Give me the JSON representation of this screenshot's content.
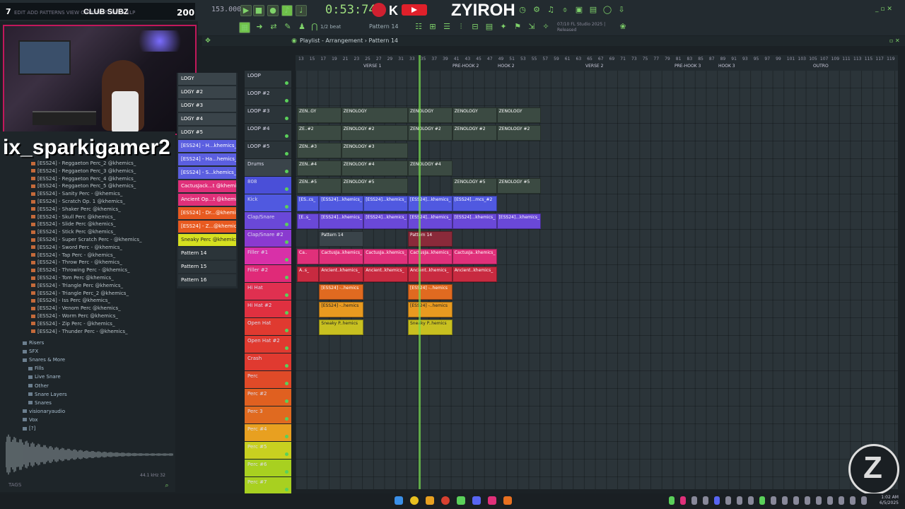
{
  "header": {
    "tempo": "153.000",
    "time": "0:53:74",
    "streamer_tag": "ZYIROH",
    "pattern": "Pattern 14",
    "snap": "1/2 beat",
    "fl_info_line1": "07/10 FL Studio 2025 |",
    "fl_info_line2": "Released"
  },
  "overlay": {
    "sub_index": "7",
    "sub_strip": "EDIT  ADD  PATTERNS  VIEW  OPTIONS  TOOLS  HELP",
    "sub_title": "CLUB SUBZ",
    "sub_count": "200",
    "username": "ix_sparkigamer2"
  },
  "breadcrumb": "Playlist - Arrangement  ›  Pattern 14",
  "browser": {
    "items": [
      "[ESS24] - Reggaeton Perc_2 @khemics_",
      "[ESS24] - Reggaeton Perc_3 @khemics_",
      "[ESS24] - Reggaeton Perc_4 @khemics_",
      "[ESS24] - Reggaeton Perc_5 @khemics_",
      "[ESS24] - Sanity Perc - @khemics_",
      "[ESS24] - Scratch Op. 1 @khemics_",
      "[ESS24] - Shaker Perc @khemics_",
      "[ESS24] - Skull Perc @khemics_",
      "[ESS24] - Slide Perc @khemics_",
      "[ESS24] - Stick Perc @khemics_",
      "[ESS24] - Super Scratch Perc - @khemics_",
      "[ESS24] - Sword Perc - @khemics_",
      "[ESS24] - Tap Perc - @khemics_",
      "[ESS24] - Throw Perc - @khemics_",
      "[ESS24] - Throwing Perc - @khemics_",
      "[ESS24] - Tom Perc @khemics_",
      "[ESS24] - Triangle Perc @khemics_",
      "[ESS24] - Triangle Perc_2 @khemics_",
      "[ESS24] - Iss Perc @khemics_",
      "[ESS24] - Venom Perc @khemics_",
      "[ESS24] - Worm Perc @khemics_",
      "[ESS24] - Zip Perc - @khemics_",
      "[ESS24] - Thunder Perc - @khemics_"
    ],
    "folders": [
      {
        "label": "Risers",
        "indent": 1
      },
      {
        "label": "SFX",
        "indent": 1
      },
      {
        "label": "Snares & More",
        "indent": 1
      },
      {
        "label": "Fills",
        "indent": 2
      },
      {
        "label": "Live Snare",
        "indent": 2
      },
      {
        "label": "Other",
        "indent": 2
      },
      {
        "label": "Snare Layers",
        "indent": 2
      },
      {
        "label": "Snares",
        "indent": 2
      },
      {
        "label": "visionaryaudio",
        "indent": 1
      },
      {
        "label": "Vox",
        "indent": 1
      },
      {
        "label": "[?]",
        "indent": 1
      }
    ],
    "sample_rate": "44.1 kHz 32",
    "tags_label": "TAGS"
  },
  "picker": [
    {
      "label": "LOGY",
      "color": "#3a444a"
    },
    {
      "label": "LOGY #2",
      "color": "#3a444a"
    },
    {
      "label": "LOGY #3",
      "color": "#3a444a"
    },
    {
      "label": "LOGY #4",
      "color": "#3a444a"
    },
    {
      "label": "LOGY #5",
      "color": "#3a444a"
    },
    {
      "label": "[ESS24] - H...khemics_",
      "color": "#5b5fe0"
    },
    {
      "label": "[ESS24] - Ha...hemics_#2",
      "color": "#5b5fe0"
    },
    {
      "label": "[ESS24] - S...khemics_",
      "color": "#5b5fe0"
    },
    {
      "label": "CactusJack...t @khemics",
      "color": "#e0307a"
    },
    {
      "label": "Ancient Op...t @khemics",
      "color": "#e0307a"
    },
    {
      "label": "[ESS24] - Dr...@khemics",
      "color": "#e85a20"
    },
    {
      "label": "[ESS24] - Z...@khemics",
      "color": "#e85a20"
    },
    {
      "label": "Sneaky Perc @khemics_",
      "color": "#d6e020"
    },
    {
      "label": "Pattern 14",
      "color": "#2b3439"
    },
    {
      "label": "Pattern 15",
      "color": "#2b3439"
    },
    {
      "label": "Pattern 16",
      "color": "#2b3439"
    }
  ],
  "tracks": [
    {
      "label": "LOOP",
      "color": "#2b3439"
    },
    {
      "label": "LOOP #2",
      "color": "#2b3439"
    },
    {
      "label": "LOOP #3",
      "color": "#2b3439"
    },
    {
      "label": "LOOP #4",
      "color": "#2b3439"
    },
    {
      "label": "LOOP #5",
      "color": "#2b3439"
    },
    {
      "label": "Drums",
      "color": "#3a444a"
    },
    {
      "label": "808",
      "color": "#4a4fd8"
    },
    {
      "label": "Kick",
      "color": "#5059e0"
    },
    {
      "label": "Clap/Snare",
      "color": "#6a48d8"
    },
    {
      "label": "Clap/Snare #2",
      "color": "#8a3ad0"
    },
    {
      "label": "Filler #1",
      "color": "#d830a8"
    },
    {
      "label": "Filler #2",
      "color": "#e02a78"
    },
    {
      "label": "Hi Hat",
      "color": "#e03050"
    },
    {
      "label": "Hi Hat #2",
      "color": "#e03040"
    },
    {
      "label": "Open Hat",
      "color": "#e03a30"
    },
    {
      "label": "Open Hat #2",
      "color": "#e03a30"
    },
    {
      "label": "Crash",
      "color": "#e03a30"
    },
    {
      "label": "Perc",
      "color": "#e04a28"
    },
    {
      "label": "Perc #2",
      "color": "#e06020"
    },
    {
      "label": "Perc 3",
      "color": "#e06a20"
    },
    {
      "label": "Perc #4",
      "color": "#e8a020"
    },
    {
      "label": "Perc #5",
      "color": "#c8d020"
    },
    {
      "label": "Perc #6",
      "color": "#a8d020"
    },
    {
      "label": "Perc #7",
      "color": "#a8d020"
    }
  ],
  "ruler": {
    "numbers": [
      "13",
      "15",
      "17",
      "19",
      "21",
      "23",
      "25",
      "27",
      "29",
      "31",
      "33",
      "35",
      "37",
      "39",
      "41",
      "43",
      "45",
      "47",
      "49",
      "51",
      "53",
      "55",
      "57",
      "59",
      "61",
      "63",
      "65",
      "67",
      "69",
      "71",
      "73",
      "75",
      "77",
      "79",
      "81",
      "83",
      "85",
      "87",
      "89",
      "91",
      "93",
      "95",
      "97",
      "99",
      "101",
      "103",
      "105",
      "107",
      "109",
      "111",
      "113",
      "115",
      "117",
      "119"
    ],
    "markers": [
      "VERSE 1",
      "PRE-HOOK 2",
      "HOOK 2",
      "VERSE 2",
      "PRE-HOOK 3",
      "HOOK 3",
      "OUTRO"
    ]
  },
  "clips": [
    {
      "row": 2,
      "start": 0,
      "len": 4,
      "label": "ZEN..GY",
      "color": "#3b4a42"
    },
    {
      "row": 2,
      "start": 4,
      "len": 6,
      "label": "ZENOLOGY",
      "color": "#3b4a42"
    },
    {
      "row": 2,
      "start": 10,
      "len": 4,
      "label": "ZENOLOGY",
      "color": "#3b4a42"
    },
    {
      "row": 2,
      "start": 14,
      "len": 4,
      "label": "ZENOLOGY",
      "color": "#3b4a42"
    },
    {
      "row": 2,
      "start": 18,
      "len": 4,
      "label": "ZENOLOGY",
      "color": "#3b4a42"
    },
    {
      "row": 3,
      "start": 0,
      "len": 4,
      "label": "ZE..#2",
      "color": "#3b4a42"
    },
    {
      "row": 3,
      "start": 4,
      "len": 6,
      "label": "ZENOLOGY #2",
      "color": "#3b4a42"
    },
    {
      "row": 3,
      "start": 10,
      "len": 4,
      "label": "ZENOLOGY #2",
      "color": "#3b4a42"
    },
    {
      "row": 3,
      "start": 14,
      "len": 4,
      "label": "ZENOLOGY #2",
      "color": "#3b4a42"
    },
    {
      "row": 3,
      "start": 18,
      "len": 4,
      "label": "ZENOLOGY #2",
      "color": "#3b4a42"
    },
    {
      "row": 4,
      "start": 0,
      "len": 4,
      "label": "ZEN..#3",
      "color": "#3b4a42"
    },
    {
      "row": 4,
      "start": 4,
      "len": 6,
      "label": "ZENOLOGY #3",
      "color": "#3b4a42"
    },
    {
      "row": 5,
      "start": 0,
      "len": 4,
      "label": "ZEN..#4",
      "color": "#3b4a42"
    },
    {
      "row": 5,
      "start": 4,
      "len": 6,
      "label": "ZENOLOGY #4",
      "color": "#3b4a42"
    },
    {
      "row": 5,
      "start": 10,
      "len": 4,
      "label": "ZENOLOGY #4",
      "color": "#3b4a42"
    },
    {
      "row": 6,
      "start": 0,
      "len": 4,
      "label": "ZEN..#5",
      "color": "#3b4a42"
    },
    {
      "row": 6,
      "start": 4,
      "len": 6,
      "label": "ZENOLOGY #5",
      "color": "#3b4a42"
    },
    {
      "row": 6,
      "start": 14,
      "len": 4,
      "label": "ZENOLOGY #5",
      "color": "#3b4a42"
    },
    {
      "row": 6,
      "start": 18,
      "len": 4,
      "label": "ZENOLOGY #5",
      "color": "#3b4a42"
    },
    {
      "row": 7,
      "start": 0,
      "len": 2,
      "label": "[ES..cs_",
      "color": "#5059e0"
    },
    {
      "row": 7,
      "start": 2,
      "len": 4,
      "label": "[ESS24]...khemics_",
      "color": "#5059e0"
    },
    {
      "row": 7,
      "start": 6,
      "len": 4,
      "label": "[ESS24]...khemics_",
      "color": "#5059e0"
    },
    {
      "row": 7,
      "start": 10,
      "len": 4,
      "label": "[ESS24]...khemics_",
      "color": "#5059e0"
    },
    {
      "row": 7,
      "start": 14,
      "len": 4,
      "label": "[ESS24]...mcs_#2",
      "color": "#5059e0"
    },
    {
      "row": 8,
      "start": 0,
      "len": 2,
      "label": "[E..s_",
      "color": "#6a48d8"
    },
    {
      "row": 8,
      "start": 2,
      "len": 4,
      "label": "[ESS24]...khemics_",
      "color": "#6a48d8"
    },
    {
      "row": 8,
      "start": 6,
      "len": 4,
      "label": "[ESS24]...khemics_",
      "color": "#6a48d8"
    },
    {
      "row": 8,
      "start": 10,
      "len": 4,
      "label": "[ESS24]...khemics_",
      "color": "#6a48d8"
    },
    {
      "row": 8,
      "start": 14,
      "len": 4,
      "label": "[ESS24]...khemics_",
      "color": "#6a48d8"
    },
    {
      "row": 8,
      "start": 18,
      "len": 4,
      "label": "[ESS24]...khemics_",
      "color": "#6a48d8"
    },
    {
      "row": 9,
      "start": 2,
      "len": 4,
      "label": "Pattern 14",
      "color": "#3a444a"
    },
    {
      "row": 9,
      "start": 10,
      "len": 4,
      "label": "Pattern 14",
      "color": "#8a2a3a"
    },
    {
      "row": 10,
      "start": 0,
      "len": 2,
      "label": "Ca..",
      "color": "#e0307a"
    },
    {
      "row": 10,
      "start": 2,
      "len": 4,
      "label": "CactusJa..khemics_",
      "color": "#e0307a"
    },
    {
      "row": 10,
      "start": 6,
      "len": 4,
      "label": "CactusJa..khemics_",
      "color": "#e0307a"
    },
    {
      "row": 10,
      "start": 10,
      "len": 4,
      "label": "CactusJa..khemics_",
      "color": "#e0307a"
    },
    {
      "row": 10,
      "start": 14,
      "len": 4,
      "label": "CactusJa..khemics_",
      "color": "#e0307a"
    },
    {
      "row": 11,
      "start": 0,
      "len": 2,
      "label": "A..s_",
      "color": "#c82a40"
    },
    {
      "row": 11,
      "start": 2,
      "len": 4,
      "label": "Ancient..khemics_",
      "color": "#c82a40"
    },
    {
      "row": 11,
      "start": 6,
      "len": 4,
      "label": "Ancient..khemics_",
      "color": "#c82a40"
    },
    {
      "row": 11,
      "start": 10,
      "len": 4,
      "label": "Ancient..khemics_",
      "color": "#c82a40"
    },
    {
      "row": 11,
      "start": 14,
      "len": 4,
      "label": "Ancient..khemics_",
      "color": "#c82a40"
    },
    {
      "row": 12,
      "start": 2,
      "len": 4,
      "label": "[ESS24] -..hemics",
      "color": "#e06a20"
    },
    {
      "row": 12,
      "start": 10,
      "len": 4,
      "label": "[ESS24] -..hemics",
      "color": "#e06a20"
    },
    {
      "row": 13,
      "start": 2,
      "len": 4,
      "label": "[ESS24] -..hemics",
      "color": "#e89a20"
    },
    {
      "row": 13,
      "start": 10,
      "len": 4,
      "label": "[ESS24] -..hemics",
      "color": "#e89a20"
    },
    {
      "row": 14,
      "start": 2,
      "len": 4,
      "label": "Sneaky P..hemics",
      "color": "#c8c020"
    },
    {
      "row": 14,
      "start": 10,
      "len": 4,
      "label": "Sneaky P..hemics",
      "color": "#c8c020"
    }
  ],
  "clock": {
    "time": "1:02 AM",
    "date": "6/5/2025"
  },
  "colors": {
    "accent": "#7fd26a",
    "playhead": "#78dc50"
  }
}
